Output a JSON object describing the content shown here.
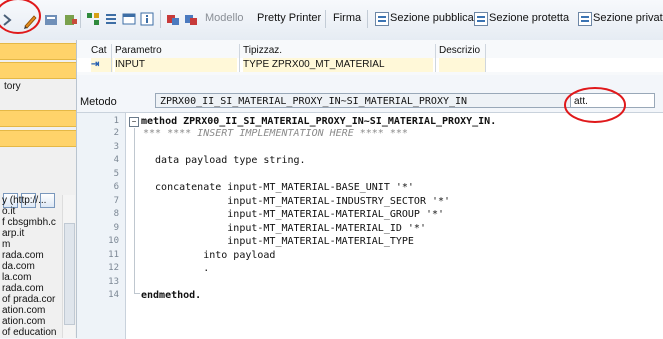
{
  "toolbar": {
    "items": [
      {
        "label": "Modello",
        "disabled": true
      },
      {
        "label": "Pretty Printer",
        "disabled": false
      },
      {
        "label": "Firma",
        "disabled": false
      },
      {
        "label": "Sezione pubblica",
        "disabled": false
      },
      {
        "label": "Sezione protetta",
        "disabled": false
      },
      {
        "label": "Sezione privata",
        "disabled": false
      }
    ]
  },
  "left": {
    "row1": "tory",
    "tree": [
      "y (http://...",
      "o.it",
      "f cbsgmbh.c",
      "arp.it",
      "m",
      "rada.com",
      "da.com",
      "la.com",
      "rada.com",
      "of prada.cor",
      "ation.com",
      "ation.com",
      "of education"
    ]
  },
  "params": {
    "headers": {
      "cat": "Cat",
      "param": "Parametro",
      "type": "Tipizzaz.",
      "desc": "Descrizio"
    },
    "rows": [
      {
        "cat_icon": "input-param-icon",
        "param": "INPUT",
        "type": "TYPE ZPRX00_MT_MATERIAL",
        "desc": ""
      }
    ]
  },
  "method": {
    "label": "Metodo",
    "value": "ZPRX00_II_SI_MATERIAL_PROXY_IN~SI_MATERIAL_PROXY_IN",
    "status": "att."
  },
  "editor": {
    "lines": [
      {
        "n": "1",
        "text": "method ZPRX00_II_SI_MATERIAL_PROXY_IN~SI_MATERIAL_PROXY_IN."
      },
      {
        "n": "2",
        "text": "*** **** INSERT IMPLEMENTATION HERE **** ***"
      },
      {
        "n": "3",
        "text": ""
      },
      {
        "n": "4",
        "text": "  data payload type string."
      },
      {
        "n": "5",
        "text": ""
      },
      {
        "n": "6",
        "text": "  concatenate input-MT_MATERIAL-BASE_UNIT '*'"
      },
      {
        "n": "7",
        "text": "              input-MT_MATERIAL-INDUSTRY_SECTOR '*'"
      },
      {
        "n": "8",
        "text": "              input-MT_MATERIAL-MATERIAL_GROUP '*'"
      },
      {
        "n": "9",
        "text": "              input-MT_MATERIAL-MATERIAL_ID '*'"
      },
      {
        "n": "10",
        "text": "              input-MT_MATERIAL-MATERIAL_TYPE"
      },
      {
        "n": "11",
        "text": "          into payload"
      },
      {
        "n": "12",
        "text": "          ."
      },
      {
        "n": "13",
        "text": ""
      },
      {
        "n": "14",
        "text": "endmethod."
      }
    ]
  },
  "colors": {
    "annotation": "#e0191b",
    "selected_bar": "#ffd36a"
  }
}
